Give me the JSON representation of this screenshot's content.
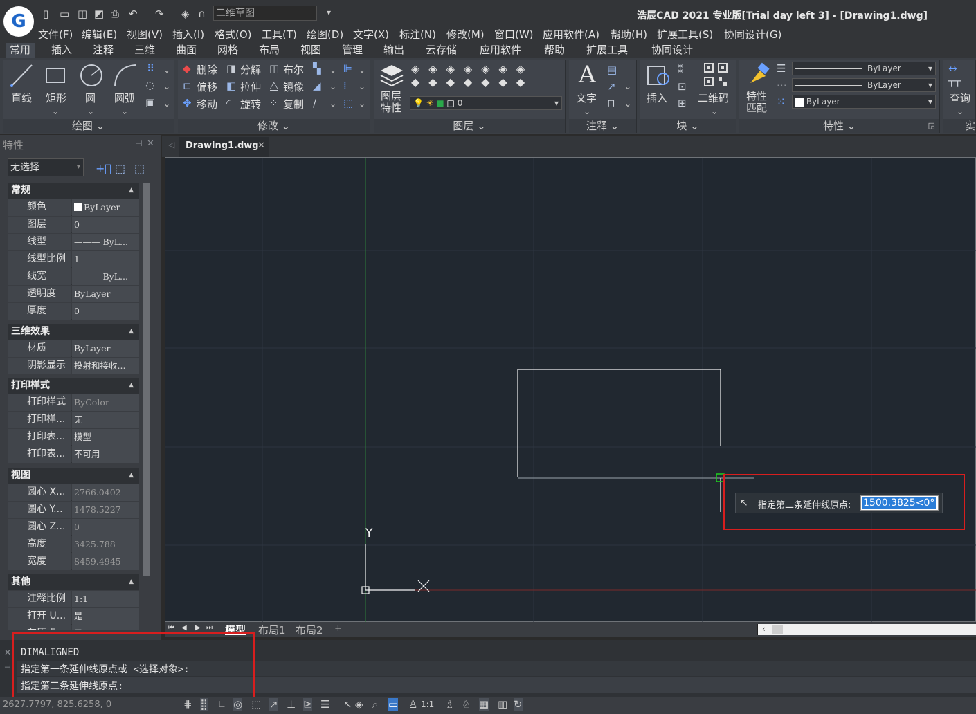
{
  "app": {
    "logo_letter": "G",
    "title": "浩辰CAD 2021 专业版[Trial day left 3] - [Drawing1.dwg]",
    "workspace": "二维草图"
  },
  "menu": [
    "文件(F)",
    "编辑(E)",
    "视图(V)",
    "插入(I)",
    "格式(O)",
    "工具(T)",
    "绘图(D)",
    "文字(X)",
    "标注(N)",
    "修改(M)",
    "窗口(W)",
    "应用软件(A)",
    "帮助(H)",
    "扩展工具(S)",
    "协同设计(G)"
  ],
  "ribbon_tabs": [
    "常用",
    "插入",
    "注释",
    "三维",
    "曲面",
    "网格",
    "布局",
    "视图",
    "管理",
    "输出",
    "云存储",
    "应用软件",
    "帮助",
    "扩展工具",
    "协同设计"
  ],
  "ribbon": {
    "draw": {
      "title": "绘图",
      "tools": [
        "直线",
        "矩形",
        "圆",
        "圆弧"
      ]
    },
    "modify": {
      "title": "修改",
      "tools": [
        "删除",
        "分解",
        "布尔",
        "偏移",
        "拉伸",
        "镜像",
        "移动",
        "旋转",
        "复制"
      ]
    },
    "layer": {
      "title": "图层",
      "tool": "图层\n特性",
      "tool_l1": "图层",
      "tool_l2": "特性",
      "current": "0"
    },
    "annotate": {
      "title": "注释",
      "tool": "文字"
    },
    "block": {
      "title": "块",
      "tools": [
        "插入",
        "二维码"
      ]
    },
    "properties": {
      "title": "特性",
      "tool_l1": "特性",
      "tool_l2": "匹配",
      "color": "ByLayer",
      "linetype": "ByLayer",
      "lineweight": "ByLayer"
    },
    "utilities": {
      "tool": "查询",
      "cut": "实"
    }
  },
  "palette": {
    "title": "特性",
    "selection": "无选择",
    "sections": [
      {
        "name": "常规",
        "rows": [
          [
            "颜色",
            "ByLayer"
          ],
          [
            "图层",
            "0"
          ],
          [
            "线型",
            "——— ByL..."
          ],
          [
            "线型比例",
            "1"
          ],
          [
            "线宽",
            "——— ByL..."
          ],
          [
            "透明度",
            "ByLayer"
          ],
          [
            "厚度",
            "0"
          ]
        ]
      },
      {
        "name": "三维效果",
        "rows": [
          [
            "材质",
            "ByLayer"
          ],
          [
            "阴影显示",
            "投射和接收..."
          ]
        ]
      },
      {
        "name": "打印样式",
        "rows": [
          [
            "打印样式",
            "ByColor"
          ],
          [
            "打印样...",
            "无"
          ],
          [
            "打印表...",
            "模型"
          ],
          [
            "打印表...",
            "不可用"
          ]
        ]
      },
      {
        "name": "视图",
        "rows": [
          [
            "圆心 X...",
            "2766.0402"
          ],
          [
            "圆心 Y...",
            "1478.5227"
          ],
          [
            "圆心 Z...",
            "0"
          ],
          [
            "高度",
            "3425.788"
          ],
          [
            "宽度",
            "8459.4945"
          ]
        ]
      },
      {
        "name": "其他",
        "rows": [
          [
            "注释比例",
            "1:1"
          ],
          [
            "打开 U...",
            "是"
          ],
          [
            "在原点...",
            "是"
          ]
        ]
      }
    ]
  },
  "document": {
    "tab": "Drawing1.dwg"
  },
  "canvas": {
    "ucs_y": "Y",
    "tooltip_prompt": "指定第二条延伸线原点:",
    "tooltip_value": "1500.3825<0°"
  },
  "layout_tabs": [
    "模型",
    "布局1",
    "布局2",
    "+"
  ],
  "command": {
    "lines": [
      "DIMALIGNED",
      "指定第一条延伸线原点或 <选择对象>:",
      "指定第二条延伸线原点:"
    ]
  },
  "status": {
    "coords": "2627.7797, 825.6258, 0",
    "scale": "1:1"
  }
}
